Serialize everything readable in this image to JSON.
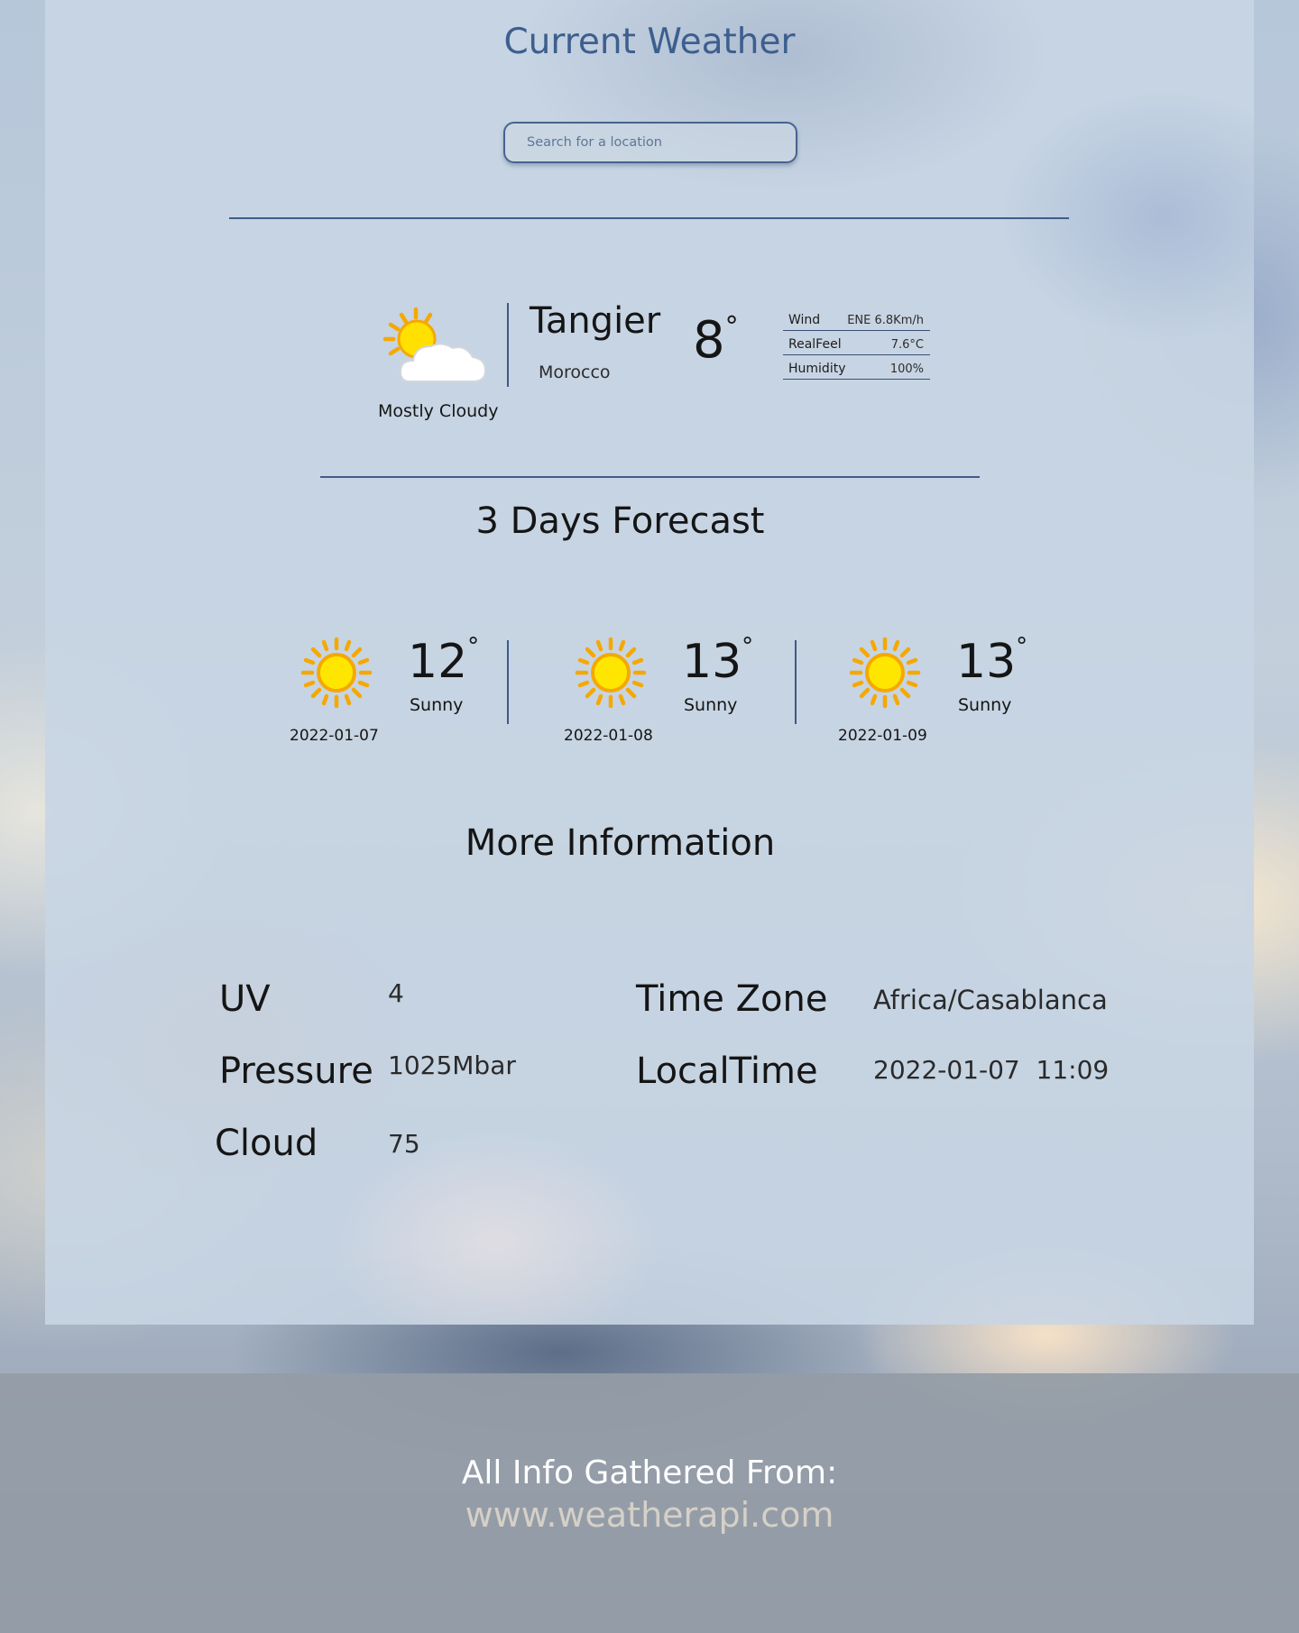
{
  "header": {
    "title": "Current Weather"
  },
  "search": {
    "placeholder": "Search for a location"
  },
  "current": {
    "condition": "Mostly Cloudy",
    "icon": "partly-cloudy-icon",
    "city": "Tangier",
    "country": "Morocco",
    "temperature": "8",
    "degree_symbol": "°",
    "details": [
      {
        "label": "Wind",
        "value": "ENE 6.8Km/h"
      },
      {
        "label": "RealFeel",
        "value": "7.6°C"
      },
      {
        "label": "Humidity",
        "value": "100%"
      }
    ]
  },
  "forecast": {
    "heading": "3 Days Forecast",
    "days": [
      {
        "date": "2022-01-07",
        "temp": "12",
        "degree_symbol": "°",
        "condition": "Sunny",
        "icon": "sun-icon"
      },
      {
        "date": "2022-01-08",
        "temp": "13",
        "degree_symbol": "°",
        "condition": "Sunny",
        "icon": "sun-icon"
      },
      {
        "date": "2022-01-09",
        "temp": "13",
        "degree_symbol": "°",
        "condition": "Sunny",
        "icon": "sun-icon"
      }
    ]
  },
  "more_info": {
    "heading": "More Information",
    "items": [
      {
        "label": "UV",
        "value": "4"
      },
      {
        "label": "Pressure",
        "value": "1025Mbar"
      },
      {
        "label": "Cloud",
        "value": "75"
      },
      {
        "label": "Time Zone",
        "value": "Africa/Casablanca"
      },
      {
        "label": "LocalTime",
        "value": "2022-01-07  11:09"
      }
    ]
  },
  "footer": {
    "text": "All Info Gathered From:",
    "link": "www.weatherapi.com"
  },
  "colors": {
    "accent": "#3d5f8e",
    "sun": "#ffe600",
    "sun_ray": "#f5a800",
    "footer_bg": "#949ca6"
  }
}
